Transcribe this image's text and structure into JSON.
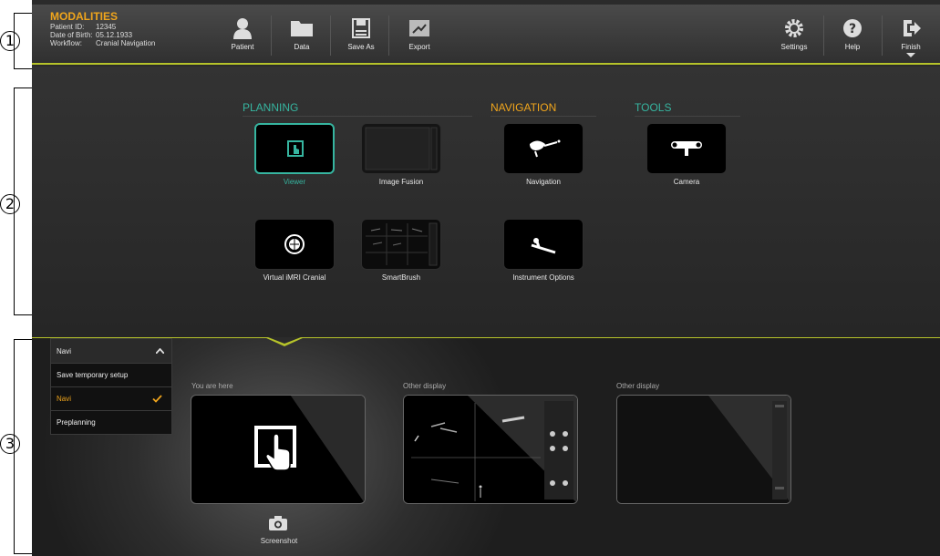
{
  "callouts": [
    "1",
    "2",
    "3"
  ],
  "patient": {
    "title": "MODALITIES",
    "id_label": "Patient ID:",
    "id_value": "12345",
    "dob_label": "Date of Birth:",
    "dob_value": "05.12.1933",
    "workflow_label": "Workflow:",
    "workflow_value": "Cranial Navigation"
  },
  "toolbar": {
    "patient": "Patient",
    "data": "Data",
    "save_as": "Save As",
    "export": "Export",
    "settings": "Settings",
    "help": "Help",
    "finish": "Finish"
  },
  "categories": {
    "planning": "PLANNING",
    "navigation": "NAVIGATION",
    "tools": "TOOLS"
  },
  "tiles": {
    "viewer": "Viewer",
    "image_fusion": "Image Fusion",
    "navigation": "Navigation",
    "camera": "Camera",
    "virtual_imri": "Virtual iMRI Cranial",
    "smartbrush": "SmartBrush",
    "instrument_options": "Instrument Options"
  },
  "menu": {
    "header": "Navi",
    "items": [
      "Save temporary setup",
      "Navi",
      "Preplanning"
    ]
  },
  "displays": {
    "current_label": "You are here",
    "other1_label": "Other display",
    "other2_label": "Other display",
    "screenshot": "Screenshot"
  },
  "colors": {
    "accent_teal": "#36b5a0",
    "accent_orange": "#f0a51c",
    "accent_lime": "#b6c32a"
  }
}
